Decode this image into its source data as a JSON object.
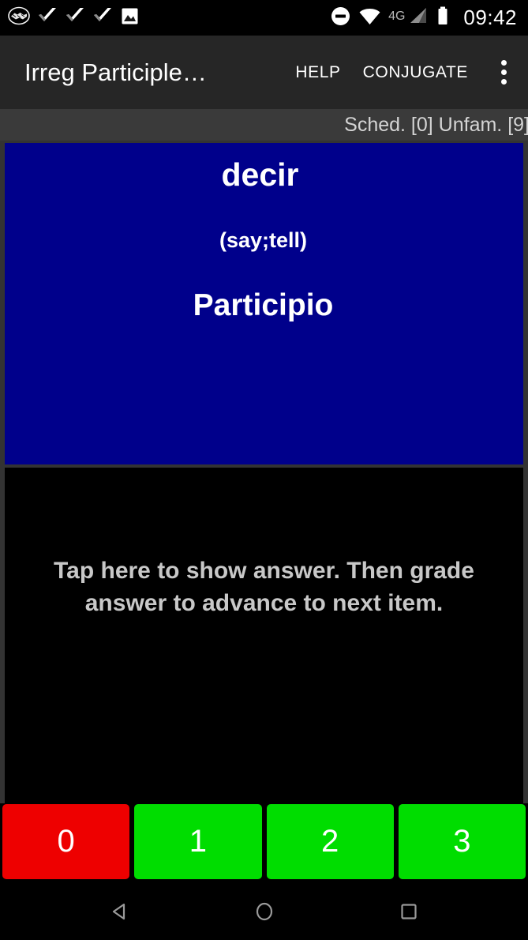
{
  "status_bar": {
    "icons_left": [
      "handshake-icon",
      "checkmark-icon",
      "checkmark-icon",
      "checkmark-icon",
      "image-icon"
    ],
    "icons_right": [
      "do-not-disturb-icon",
      "wifi-icon",
      "signal-icon",
      "battery-icon"
    ],
    "network_label": "4G",
    "time": "09:42"
  },
  "app_bar": {
    "title": "Irreg Participle…",
    "help_label": "HELP",
    "conjugate_label": "CONJUGATE",
    "overflow_icon": "overflow-menu-icon"
  },
  "sched_strip": {
    "text": "Sched. [0] Unfam. [9]"
  },
  "question": {
    "term": "decir",
    "gloss": "(say;tell)",
    "tense": "Participio",
    "background_color": "#00008b"
  },
  "answer": {
    "hint": "Tap here to show answer. Then grade answer to advance to next item."
  },
  "grade_buttons": [
    {
      "label": "0",
      "color": "#ee0000"
    },
    {
      "label": "1",
      "color": "#00dd00"
    },
    {
      "label": "2",
      "color": "#00dd00"
    },
    {
      "label": "3",
      "color": "#00dd00"
    }
  ],
  "nav_bar": {
    "back_icon": "back-triangle-icon",
    "home_icon": "home-circle-icon",
    "recents_icon": "recents-square-icon"
  }
}
